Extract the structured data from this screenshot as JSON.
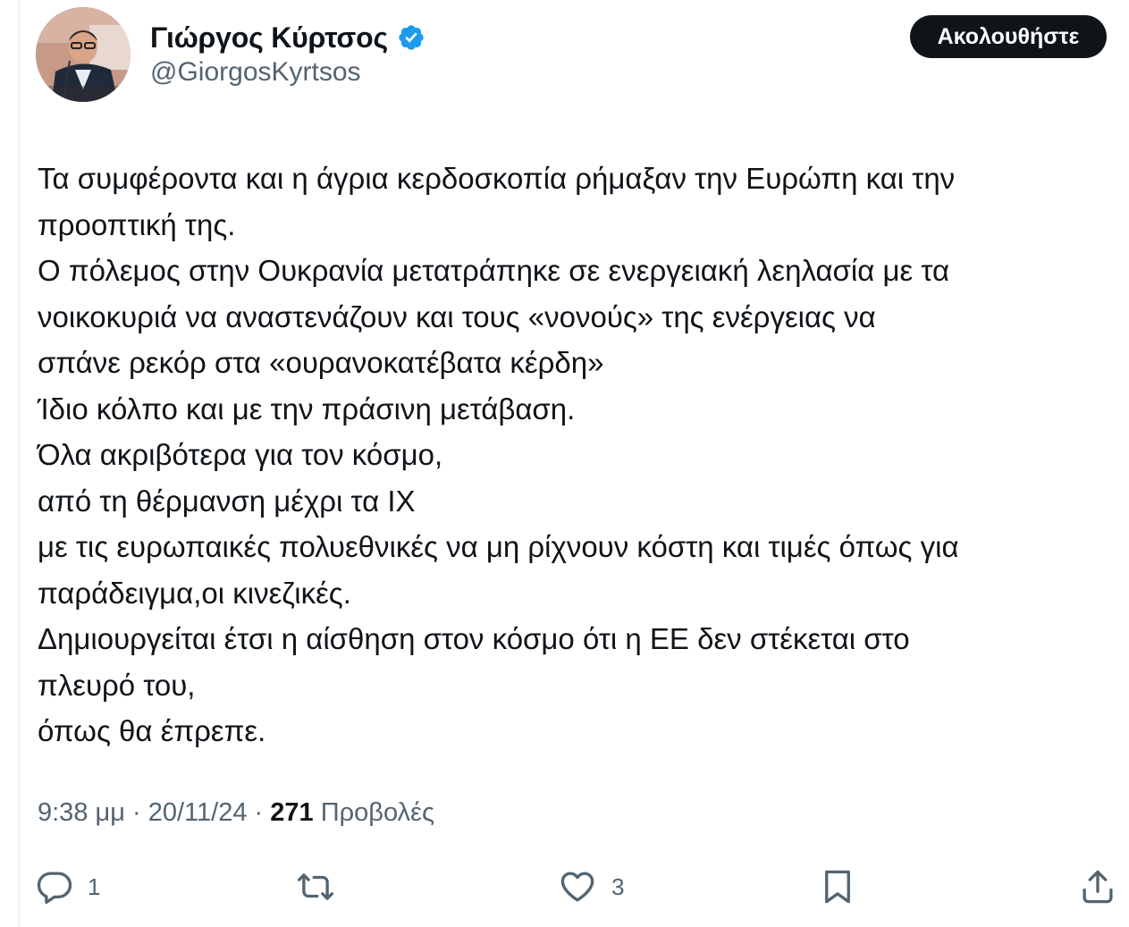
{
  "author": {
    "display_name": "Γιώργος Κύρτσος",
    "handle": "@GiorgosKyrtsos",
    "verified": true,
    "verified_color": "#1d9bf0"
  },
  "follow_button": {
    "label": "Ακολουθήστε"
  },
  "tweet": {
    "lines": [
      "Τα συμφέροντα και η άγρια κερδοσκοπία ρήμαξαν την Ευρώπη και την",
      "προοπτική της.",
      "Ο πόλεμος στην Ουκρανία μετατράπηκε σε ενεργειακή λεηλασία με τα",
      "νοικοκυριά να αναστενάζουν και τους «νονούς» της ενέργειας να",
      "σπάνε ρεκόρ στα «ουρανοκατέβατα κέρδη»",
      "Ίδιο κόλπο και με την πράσινη μετάβαση.",
      "Όλα ακριβότερα για τον κόσμο,",
      "από τη θέρμανση μέχρι τα ΙΧ",
      "με τις ευρωπαικές πολυεθνικές να μη ρίχνουν κόστη και τιμές όπως για",
      "παράδειγμα,οι κινεζικές.",
      "Δημιουργείται έτσι η αίσθηση στον κόσμο ότι η ΕΕ δεν στέκεται στο",
      "πλευρό του,",
      "όπως θα έπρεπε."
    ],
    "time": "9:38 μμ",
    "separator": "·",
    "date": "20/11/24",
    "views_count": "271",
    "views_label": "Προβολές"
  },
  "actions": {
    "reply_count": "1",
    "retweet_count": "",
    "like_count": "3"
  },
  "icons": {
    "reply": "reply-icon",
    "retweet": "retweet-icon",
    "like": "heart-icon",
    "bookmark": "bookmark-icon",
    "share": "share-icon"
  },
  "colors": {
    "text_primary": "#0f1419",
    "text_secondary": "#536471",
    "button_bg": "#0f1419",
    "button_text": "#ffffff"
  }
}
